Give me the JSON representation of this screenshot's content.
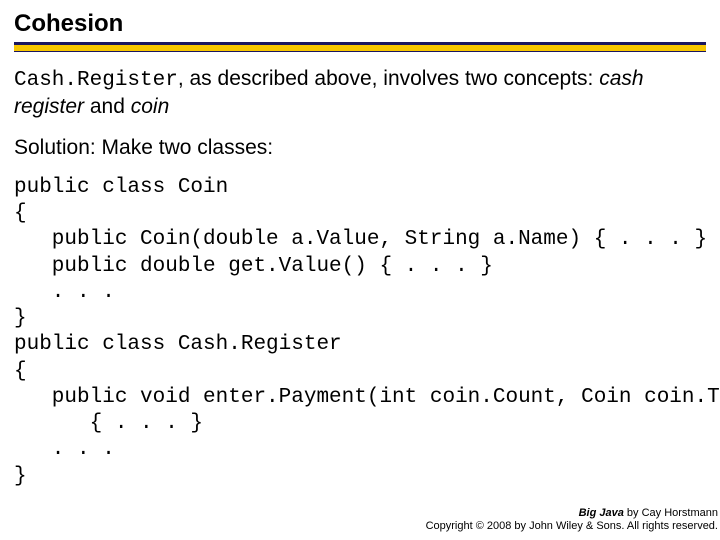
{
  "title": "Cohesion",
  "para1": {
    "code": "Cash.Register",
    "mid": ", as described above, involves two concepts: ",
    "ital1": "cash register",
    "mid2": " and ",
    "ital2": "coin"
  },
  "para2": "Solution: Make two classes:",
  "code": "public class Coin\n{\n   public Coin(double a.Value, String a.Name) { . . . }\n   public double get.Value() { . . . }\n   . . .\n}\npublic class Cash.Register\n{\n   public void enter.Payment(int coin.Count, Coin coin.Type)\n      { . . . }\n   . . .\n}",
  "footer": {
    "book": "Big Java",
    "author": " by Cay Horstmann",
    "copyright": "Copyright © 2008 by John Wiley & Sons.  All rights reserved."
  }
}
